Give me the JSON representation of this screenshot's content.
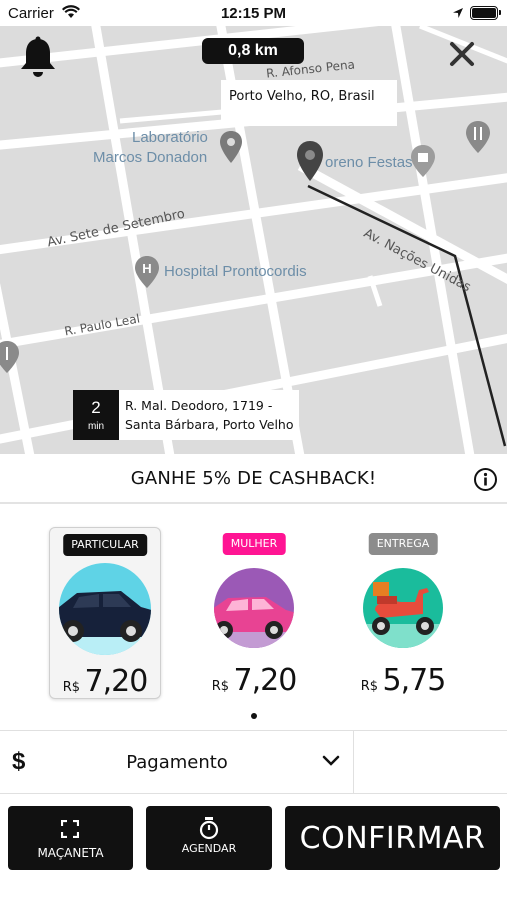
{
  "status_bar": {
    "carrier": "Carrier",
    "time": "12:15 PM"
  },
  "map": {
    "distance": "0,8 km",
    "destination_label": "Porto Velho, RO, Brasil",
    "places": {
      "lab_line1": "Laboratório",
      "lab_line2": "Marcos Donadon",
      "festas": "oreno Festas",
      "hospital": "Hospital Prontocordis"
    },
    "streets": {
      "afonso_pena": "R. Afonso Pena",
      "sete_setembro": "Av. Sete de Setembro",
      "nacoes_unidas": "Av. Nações Unidas",
      "paulo_leal": "R. Paulo Leal"
    },
    "eta": {
      "value": "2",
      "unit": "min"
    },
    "origin": {
      "line1": "R. Mal. Deodoro, 1719 -",
      "line2": "Santa Bárbara, Porto Velho"
    }
  },
  "cashback": {
    "text": "GANHE 5% DE CASHBACK!"
  },
  "vehicles": [
    {
      "tag": "PARTICULAR",
      "tag_color": "#111111",
      "currency": "R$",
      "price": "7,20",
      "selected": true
    },
    {
      "tag": "MULHER",
      "tag_color": "#ff1493",
      "currency": "R$",
      "price": "7,20",
      "selected": false
    },
    {
      "tag": "ENTREGA",
      "tag_color": "#8c8c8c",
      "currency": "R$",
      "price": "5,75",
      "selected": false
    }
  ],
  "payment": {
    "symbol": "$",
    "label": "Pagamento"
  },
  "actions": {
    "macaneta_label": "MAÇANETA",
    "agendar_label": "AGENDAR",
    "confirm_label": "CONFIRMAR"
  }
}
